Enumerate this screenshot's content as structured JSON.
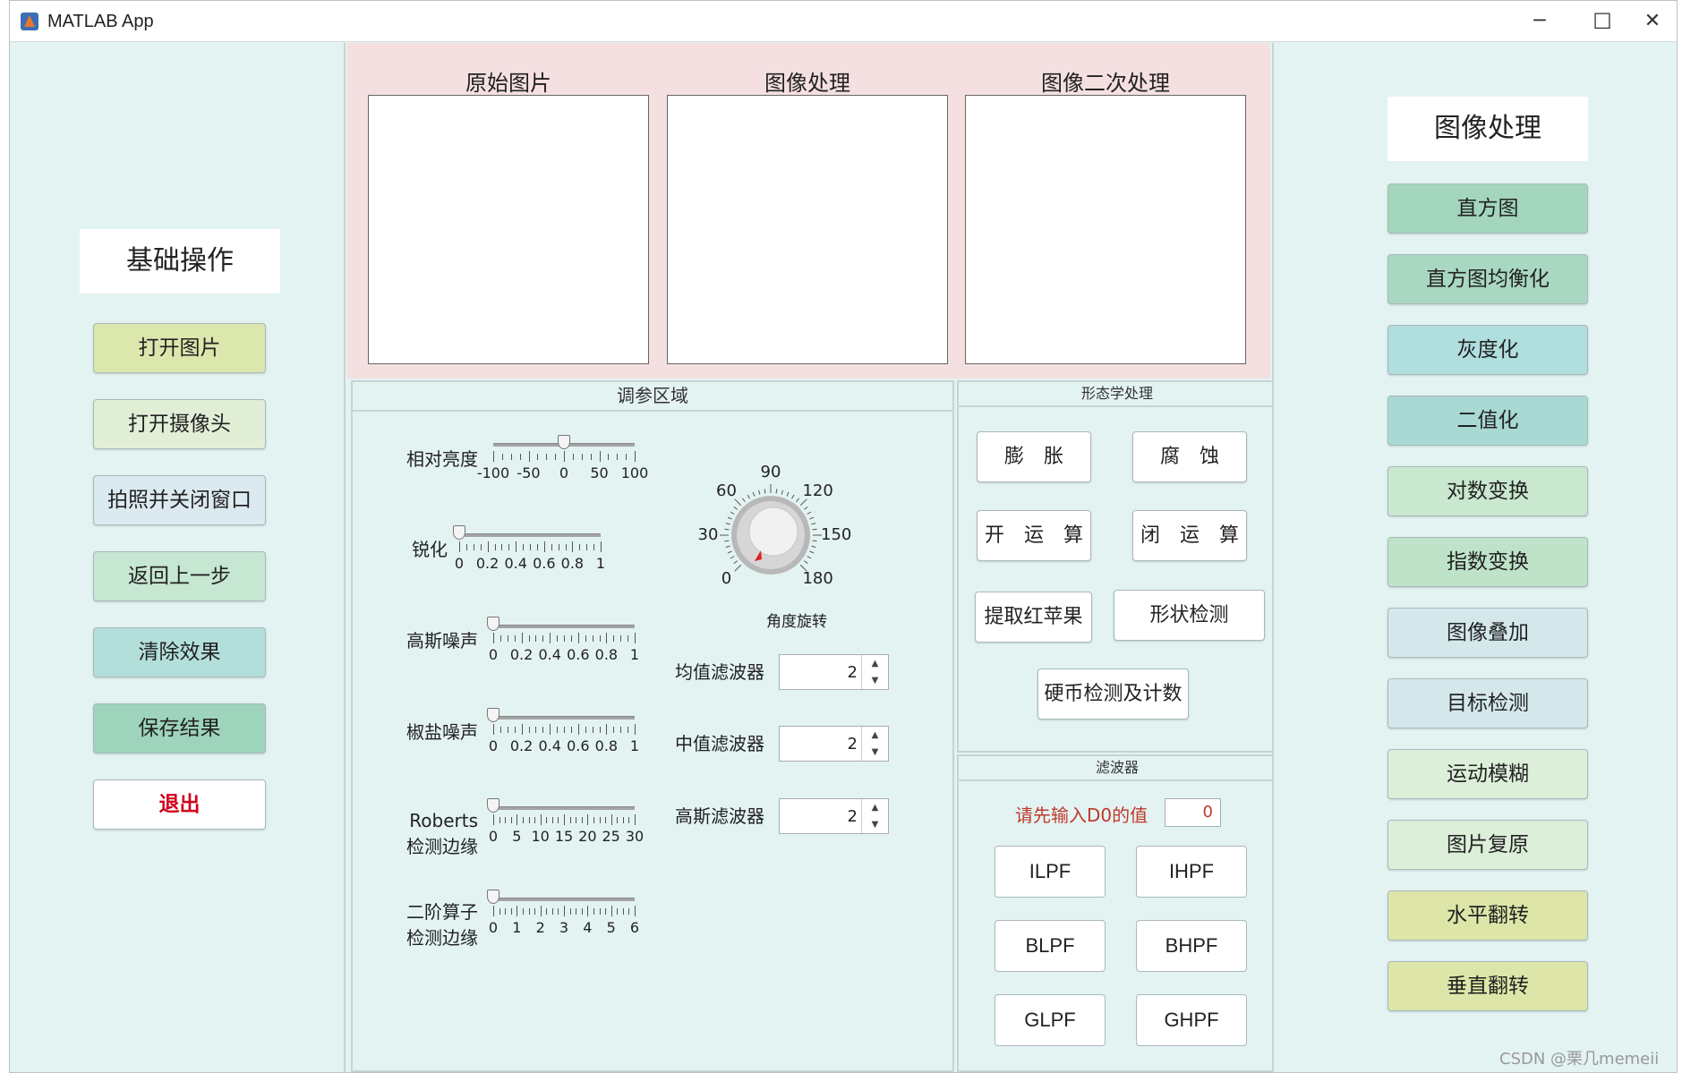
{
  "window": {
    "title": "MATLAB App",
    "minimize": "─",
    "maximize": "☐",
    "close": "✕"
  },
  "left": {
    "header": "基础操作",
    "buttons": [
      {
        "label": "打开图片",
        "color": "#dbe7ad"
      },
      {
        "label": "打开摄像头",
        "color": "#e2efd7"
      },
      {
        "label": "拍照并关闭窗口",
        "color": "#dbeaf0"
      },
      {
        "label": "返回上一步",
        "color": "#c6e7d2"
      },
      {
        "label": "清除效果",
        "color": "#b3dfdb"
      },
      {
        "label": "保存结果",
        "color": "#9ed4bc"
      },
      {
        "label": "退出",
        "color": "#ffffff",
        "text_color": "#d0021b"
      }
    ]
  },
  "images": {
    "titles": [
      "原始图片",
      "图像处理",
      "图像二次处理"
    ]
  },
  "params": {
    "title": "调参区域",
    "sliders": [
      {
        "label1": "相对亮度",
        "label2": "",
        "ticks": [
          "-100",
          "-50",
          "0",
          "50",
          "100"
        ],
        "value": 0,
        "min": -100,
        "max": 100
      },
      {
        "label1": "锐化",
        "label2": "",
        "ticks": [
          "0",
          "0.2",
          "0.4",
          "0.6",
          "0.8",
          "1"
        ],
        "value": 0,
        "min": 0,
        "max": 1
      },
      {
        "label1": "高斯噪声",
        "label2": "",
        "ticks": [
          "0",
          "0.2",
          "0.4",
          "0.6",
          "0.8",
          "1"
        ],
        "value": 0,
        "min": 0,
        "max": 1
      },
      {
        "label1": "椒盐噪声",
        "label2": "",
        "ticks": [
          "0",
          "0.2",
          "0.4",
          "0.6",
          "0.8",
          "1"
        ],
        "value": 0,
        "min": 0,
        "max": 1
      },
      {
        "label1": "Roberts",
        "label2": "检测边缘",
        "ticks": [
          "0",
          "5",
          "10",
          "15",
          "20",
          "25",
          "30"
        ],
        "value": 0,
        "min": 0,
        "max": 30
      },
      {
        "label1": "二阶算子",
        "label2": "检测边缘",
        "ticks": [
          "0",
          "1",
          "2",
          "3",
          "4",
          "5",
          "6"
        ],
        "value": 0,
        "min": 0,
        "max": 6
      }
    ],
    "knob": {
      "label": "角度旋转",
      "ticks": [
        "0",
        "30",
        "60",
        "90",
        "120",
        "150",
        "180"
      ],
      "value": 0
    },
    "filters": [
      {
        "label": "均值滤波器",
        "value": "2"
      },
      {
        "label": "中值滤波器",
        "value": "2"
      },
      {
        "label": "高斯滤波器",
        "value": "2"
      }
    ]
  },
  "morph": {
    "title": "形态学处理",
    "buttons": [
      "膨　胀",
      "腐　蚀",
      "开　运　算",
      "闭　运　算",
      "提取红苹果",
      "形状检测",
      "硬币检测及计数"
    ]
  },
  "filter": {
    "title": "滤波器",
    "prompt": "请先输入D0的值",
    "d0": "0",
    "buttons": [
      "ILPF",
      "IHPF",
      "BLPF",
      "BHPF",
      "GLPF",
      "GHPF"
    ]
  },
  "right": {
    "header": "图像处理",
    "buttons": [
      {
        "label": "直方图",
        "color": "#a3d6bd"
      },
      {
        "label": "直方图均衡化",
        "color": "#a9d8c2"
      },
      {
        "label": "灰度化",
        "color": "#b1dede"
      },
      {
        "label": "二值化",
        "color": "#a9d9d3"
      },
      {
        "label": "对数变换",
        "color": "#c9e8cf"
      },
      {
        "label": "指数变换",
        "color": "#bfe3c8"
      },
      {
        "label": "图像叠加",
        "color": "#d4e8ec"
      },
      {
        "label": "目标检测",
        "color": "#d4e8ec"
      },
      {
        "label": "运动模糊",
        "color": "#dcefd9"
      },
      {
        "label": "图片复原",
        "color": "#dcefd9"
      },
      {
        "label": "水平翻转",
        "color": "#dde6a8"
      },
      {
        "label": "垂直翻转",
        "color": "#dde6a8"
      }
    ]
  },
  "watermark": "CSDN @栗几memeii"
}
